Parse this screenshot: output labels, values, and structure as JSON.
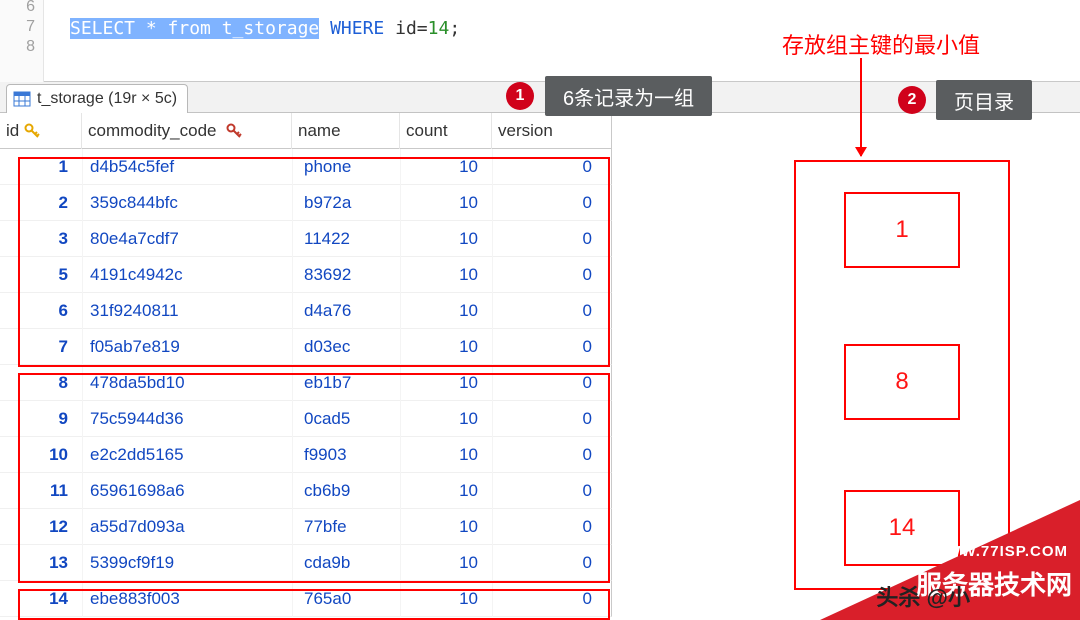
{
  "editor": {
    "line_numbers": [
      "6",
      "7",
      "8"
    ],
    "sql_selected": "SELECT * from t_storage",
    "sql_where": " WHERE",
    "sql_cond": " id",
    "sql_eq": "=",
    "sql_val": "14",
    "sql_end": ";"
  },
  "tab": {
    "label": "t_storage (19r × 5c)"
  },
  "columns": {
    "id": "id",
    "commodity_code": "commodity_code",
    "name": "name",
    "count": "count",
    "version": "version"
  },
  "rows": [
    {
      "id": "1",
      "code": "d4b54c5fef",
      "name": "phone",
      "count": "10",
      "version": "0"
    },
    {
      "id": "2",
      "code": "359c844bfc",
      "name": "b972a",
      "count": "10",
      "version": "0"
    },
    {
      "id": "3",
      "code": "80e4a7cdf7",
      "name": "11422",
      "count": "10",
      "version": "0"
    },
    {
      "id": "5",
      "code": "4191c4942c",
      "name": "83692",
      "count": "10",
      "version": "0"
    },
    {
      "id": "6",
      "code": "31f9240811",
      "name": "d4a76",
      "count": "10",
      "version": "0"
    },
    {
      "id": "7",
      "code": "f05ab7e819",
      "name": "d03ec",
      "count": "10",
      "version": "0"
    },
    {
      "id": "8",
      "code": "478da5bd10",
      "name": "eb1b7",
      "count": "10",
      "version": "0"
    },
    {
      "id": "9",
      "code": "75c5944d36",
      "name": "0cad5",
      "count": "10",
      "version": "0"
    },
    {
      "id": "10",
      "code": "e2c2dd5165",
      "name": "f9903",
      "count": "10",
      "version": "0"
    },
    {
      "id": "11",
      "code": "65961698a6",
      "name": "cb6b9",
      "count": "10",
      "version": "0"
    },
    {
      "id": "12",
      "code": "a55d7d093a",
      "name": "77bfe",
      "count": "10",
      "version": "0"
    },
    {
      "id": "13",
      "code": "5399cf9f19",
      "name": "cda9b",
      "count": "10",
      "version": "0"
    },
    {
      "id": "14",
      "code": "ebe883f003",
      "name": "765a0",
      "count": "10",
      "version": "0"
    }
  ],
  "callouts": {
    "badge1": "1",
    "text1": "6条记录为一组",
    "badge2": "2",
    "text2": "页目录",
    "note": "存放组主键的最小值"
  },
  "page_dir": {
    "v1": "1",
    "v2": "8",
    "v3": "14"
  },
  "watermark": {
    "url": "WWW.77ISP.COM",
    "title": "服务器技术网",
    "credit": "头杀 @小"
  },
  "colors": {
    "accent": "#ff0000",
    "badge": "#d0021b",
    "callout": "#5a5d5f",
    "link": "#1147c1"
  }
}
